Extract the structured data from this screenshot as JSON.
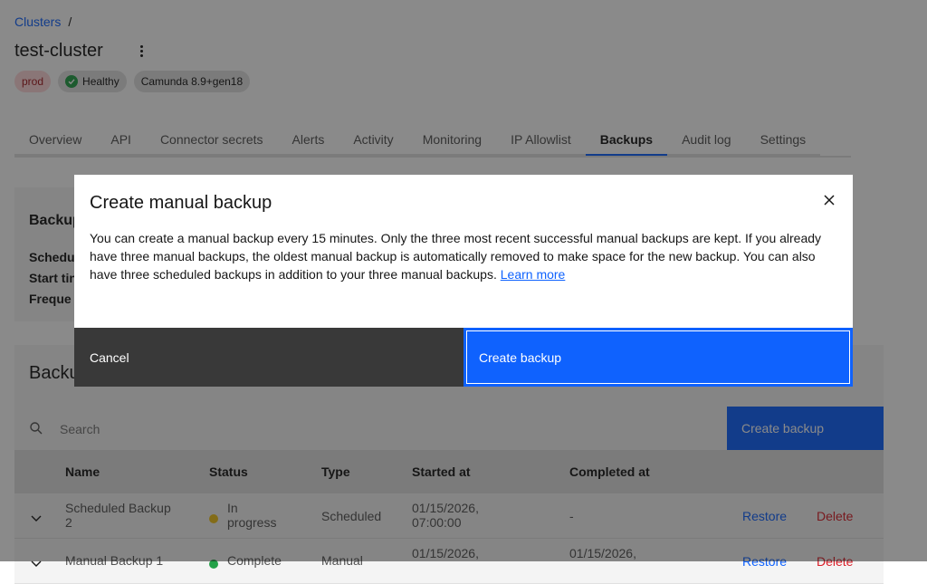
{
  "breadcrumb": {
    "link": "Clusters",
    "separator": "/"
  },
  "cluster": {
    "name": "test-cluster",
    "menu_icon": "overflow-menu-icon"
  },
  "tags": {
    "env": "prod",
    "health": "Healthy",
    "version": "Camunda 8.9+gen18"
  },
  "tabs": [
    "Overview",
    "API",
    "Connector secrets",
    "Alerts",
    "Activity",
    "Monitoring",
    "IP Allowlist",
    "Backups",
    "Audit log",
    "Settings"
  ],
  "active_tab": "Backups",
  "schedule_card": {
    "title": "Backup",
    "labels": [
      "Schedu",
      "Start tin",
      "Freque"
    ]
  },
  "backups_card": {
    "title": "Backu"
  },
  "search": {
    "placeholder": "Search"
  },
  "create_button": "Create backup",
  "table": {
    "headers": [
      "Name",
      "Status",
      "Type",
      "Started at",
      "Completed at"
    ],
    "rows": [
      {
        "name1": "Scheduled Backup",
        "name2": "2",
        "status1": "In",
        "status2": "progress",
        "status_color": "#f1c21b",
        "type": "Scheduled",
        "started1": "01/15/2026,",
        "started2": "07:00:00",
        "completed1": "-",
        "completed2": "",
        "restore": "Restore",
        "delete": "Delete"
      },
      {
        "name1": "Manual Backup 1",
        "name2": "",
        "status1": "Complete",
        "status2": "",
        "status_color": "#24a148",
        "type": "Manual",
        "started1": "01/15/2026,",
        "started2": "",
        "completed1": "01/15/2026,",
        "completed2": "",
        "restore": "Restore",
        "delete": "Delete"
      }
    ]
  },
  "modal": {
    "title": "Create manual backup",
    "body": "You can create a manual backup every 15 minutes. Only the three most recent successful manual backups are kept. If you already have three manual backups, the oldest manual backup is automatically removed to make space for the new backup. You can also have three scheduled backups in addition to your three manual backups.",
    "link": "Learn more",
    "cancel": "Cancel",
    "confirm": "Create backup"
  },
  "colors": {
    "primary": "#0f62fe",
    "danger": "#da1e28",
    "success": "#24a148",
    "warning": "#f1c21b"
  }
}
